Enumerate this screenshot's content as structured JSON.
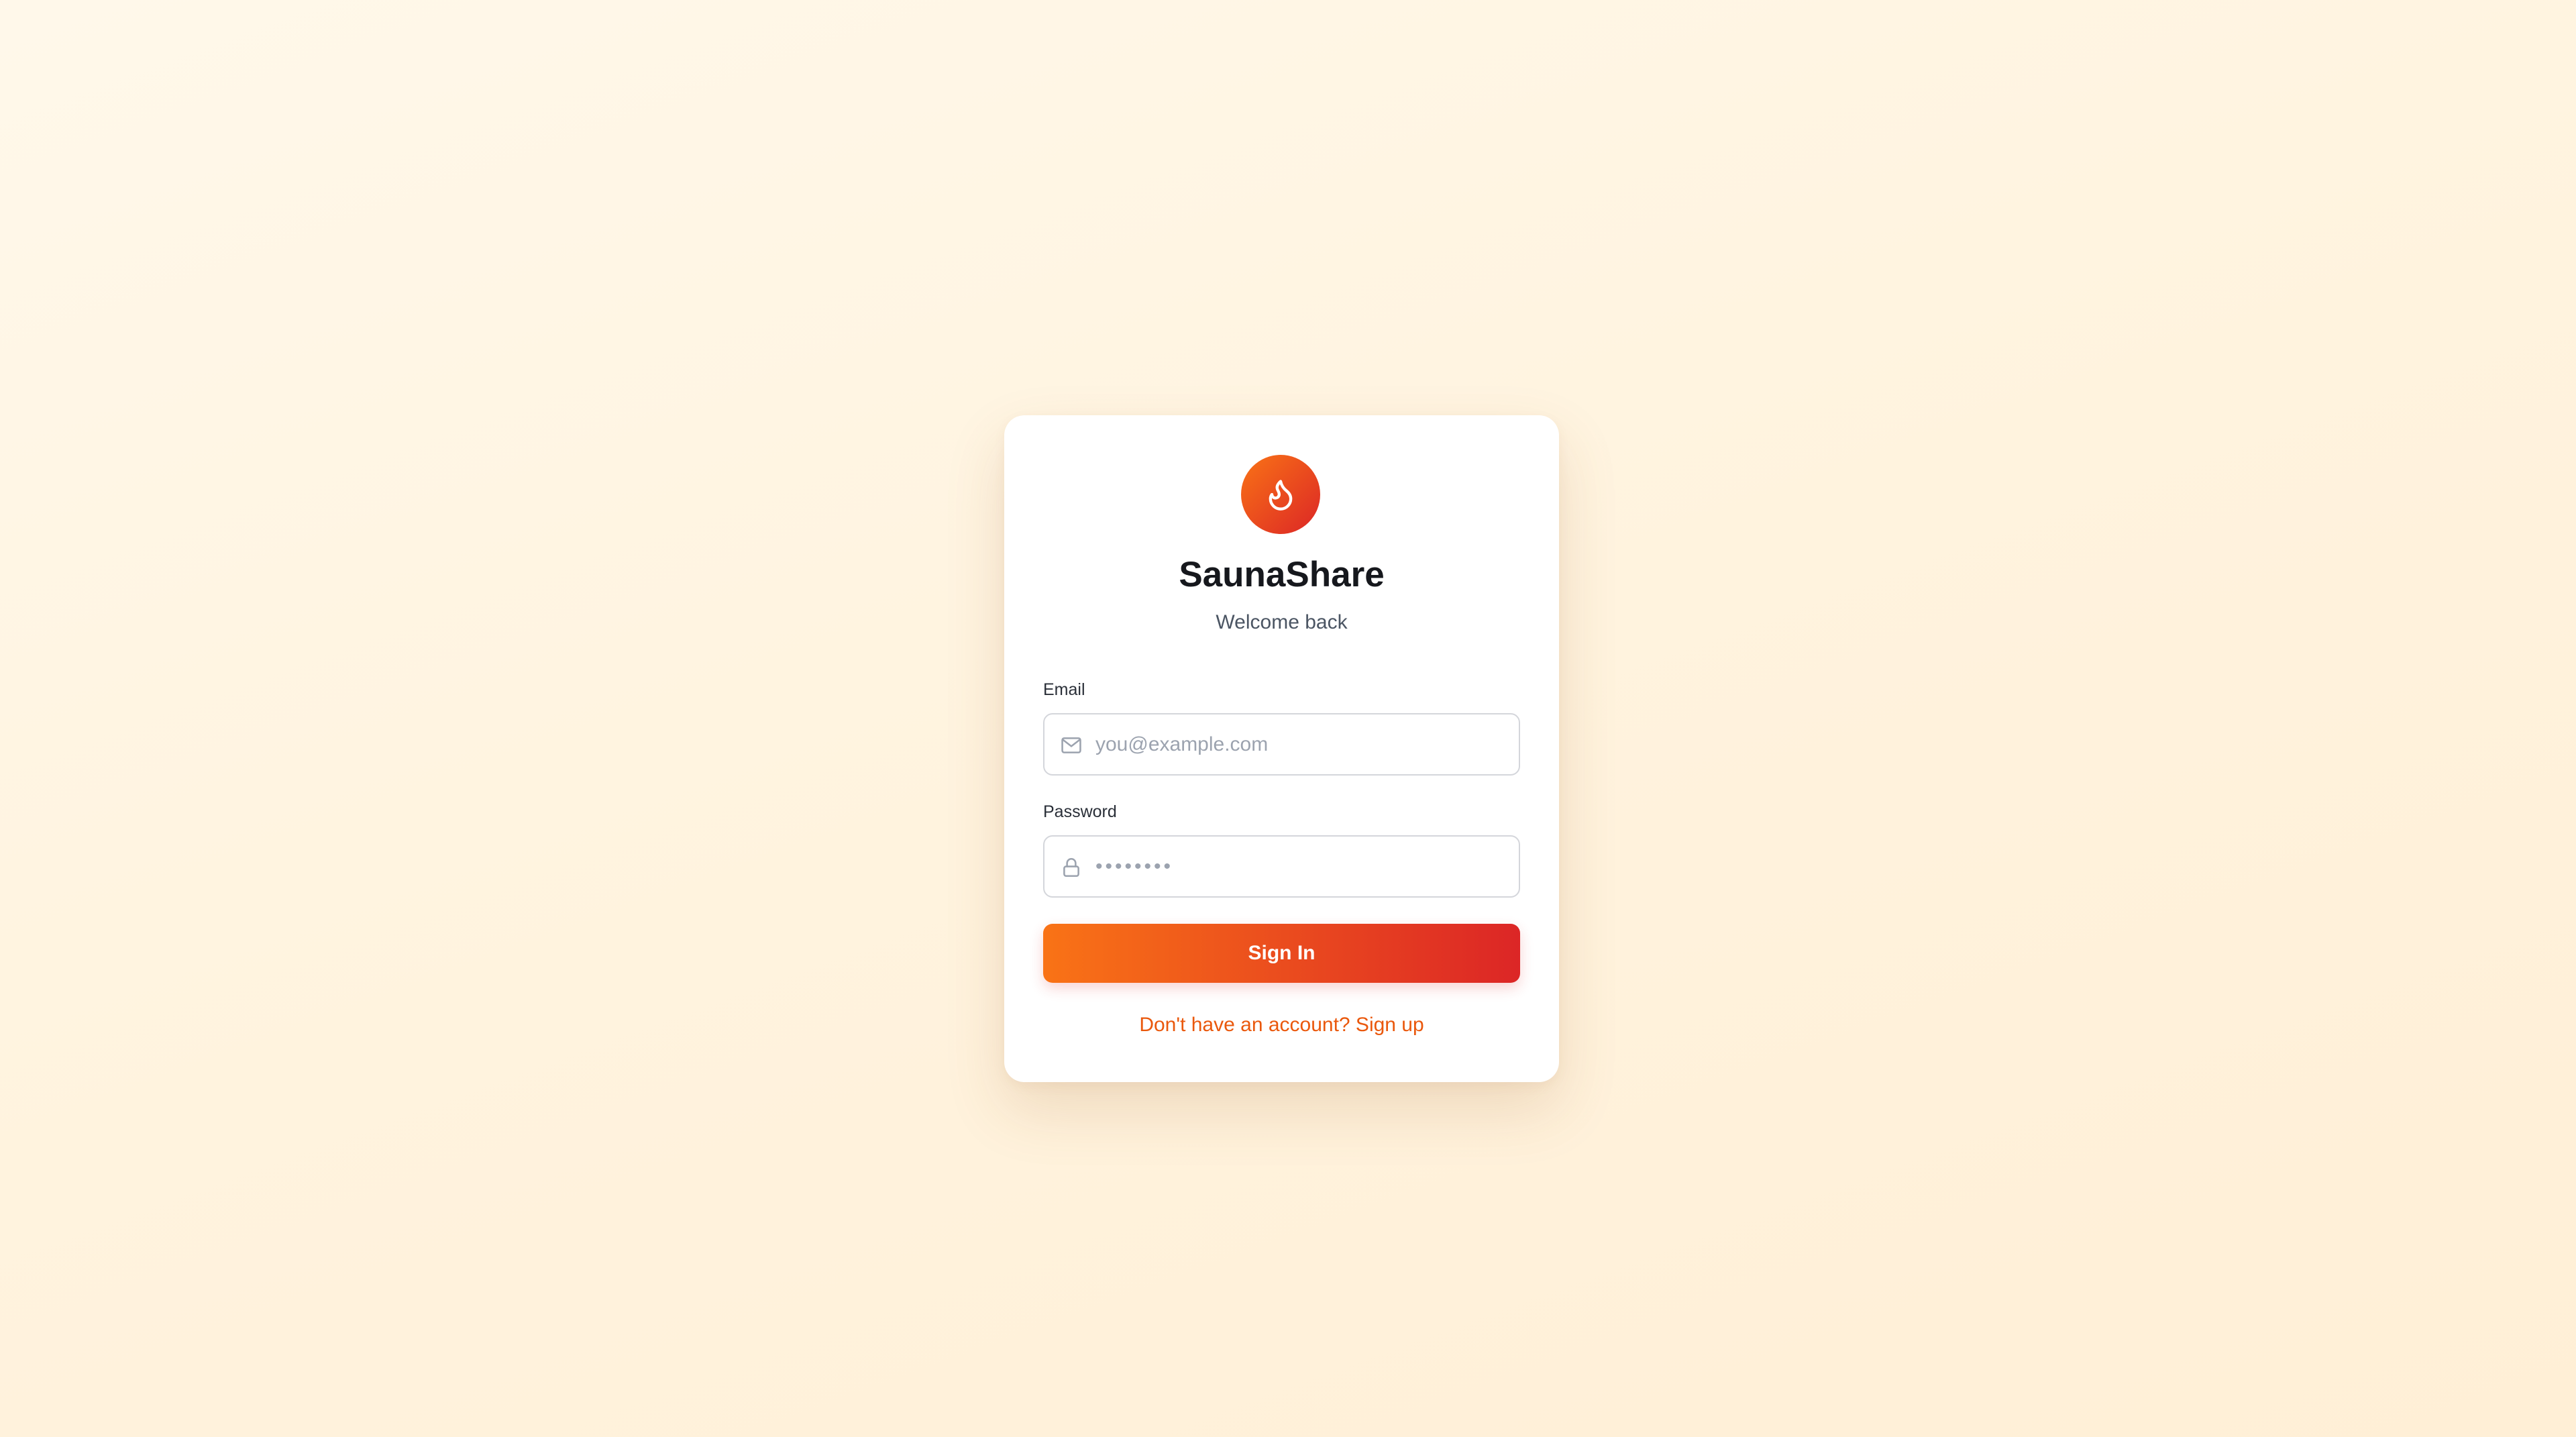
{
  "app": {
    "name": "SaunaShare",
    "subtitle": "Welcome back",
    "logo_icon": "flame-icon"
  },
  "form": {
    "email": {
      "label": "Email",
      "placeholder": "you@example.com",
      "value": "",
      "icon": "mail-icon"
    },
    "password": {
      "label": "Password",
      "placeholder": "••••••••",
      "value": "",
      "icon": "lock-icon"
    },
    "submit_label": "Sign In",
    "signup_link": "Don't have an account? Sign up"
  },
  "colors": {
    "accent_start": "#f97316",
    "accent_end": "#dc2626",
    "link": "#ea580c",
    "background": "#fff6e6"
  }
}
